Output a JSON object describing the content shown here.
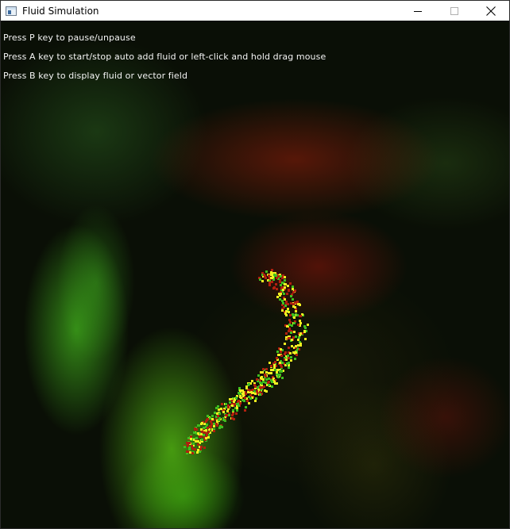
{
  "window": {
    "title": "Fluid Simulation",
    "icon": "app-window-icon",
    "controls": [
      {
        "name": "minimize-button",
        "icon": "minimize-icon"
      },
      {
        "name": "maximize-button",
        "icon": "maximize-icon"
      },
      {
        "name": "close-button",
        "icon": "close-icon"
      }
    ]
  },
  "canvas": {
    "mode": "fluid",
    "colors": {
      "background": "#000000",
      "fluid_green": "#3fbf1f",
      "fluid_red": "#b0200f",
      "particle_yellow": "#f0f020"
    },
    "instructions": [
      "Press P key to pause/unpause",
      "Press A key to start/stop auto add fluid or left-click and hold drag mouse",
      "Press B key to display fluid or vector field"
    ]
  }
}
